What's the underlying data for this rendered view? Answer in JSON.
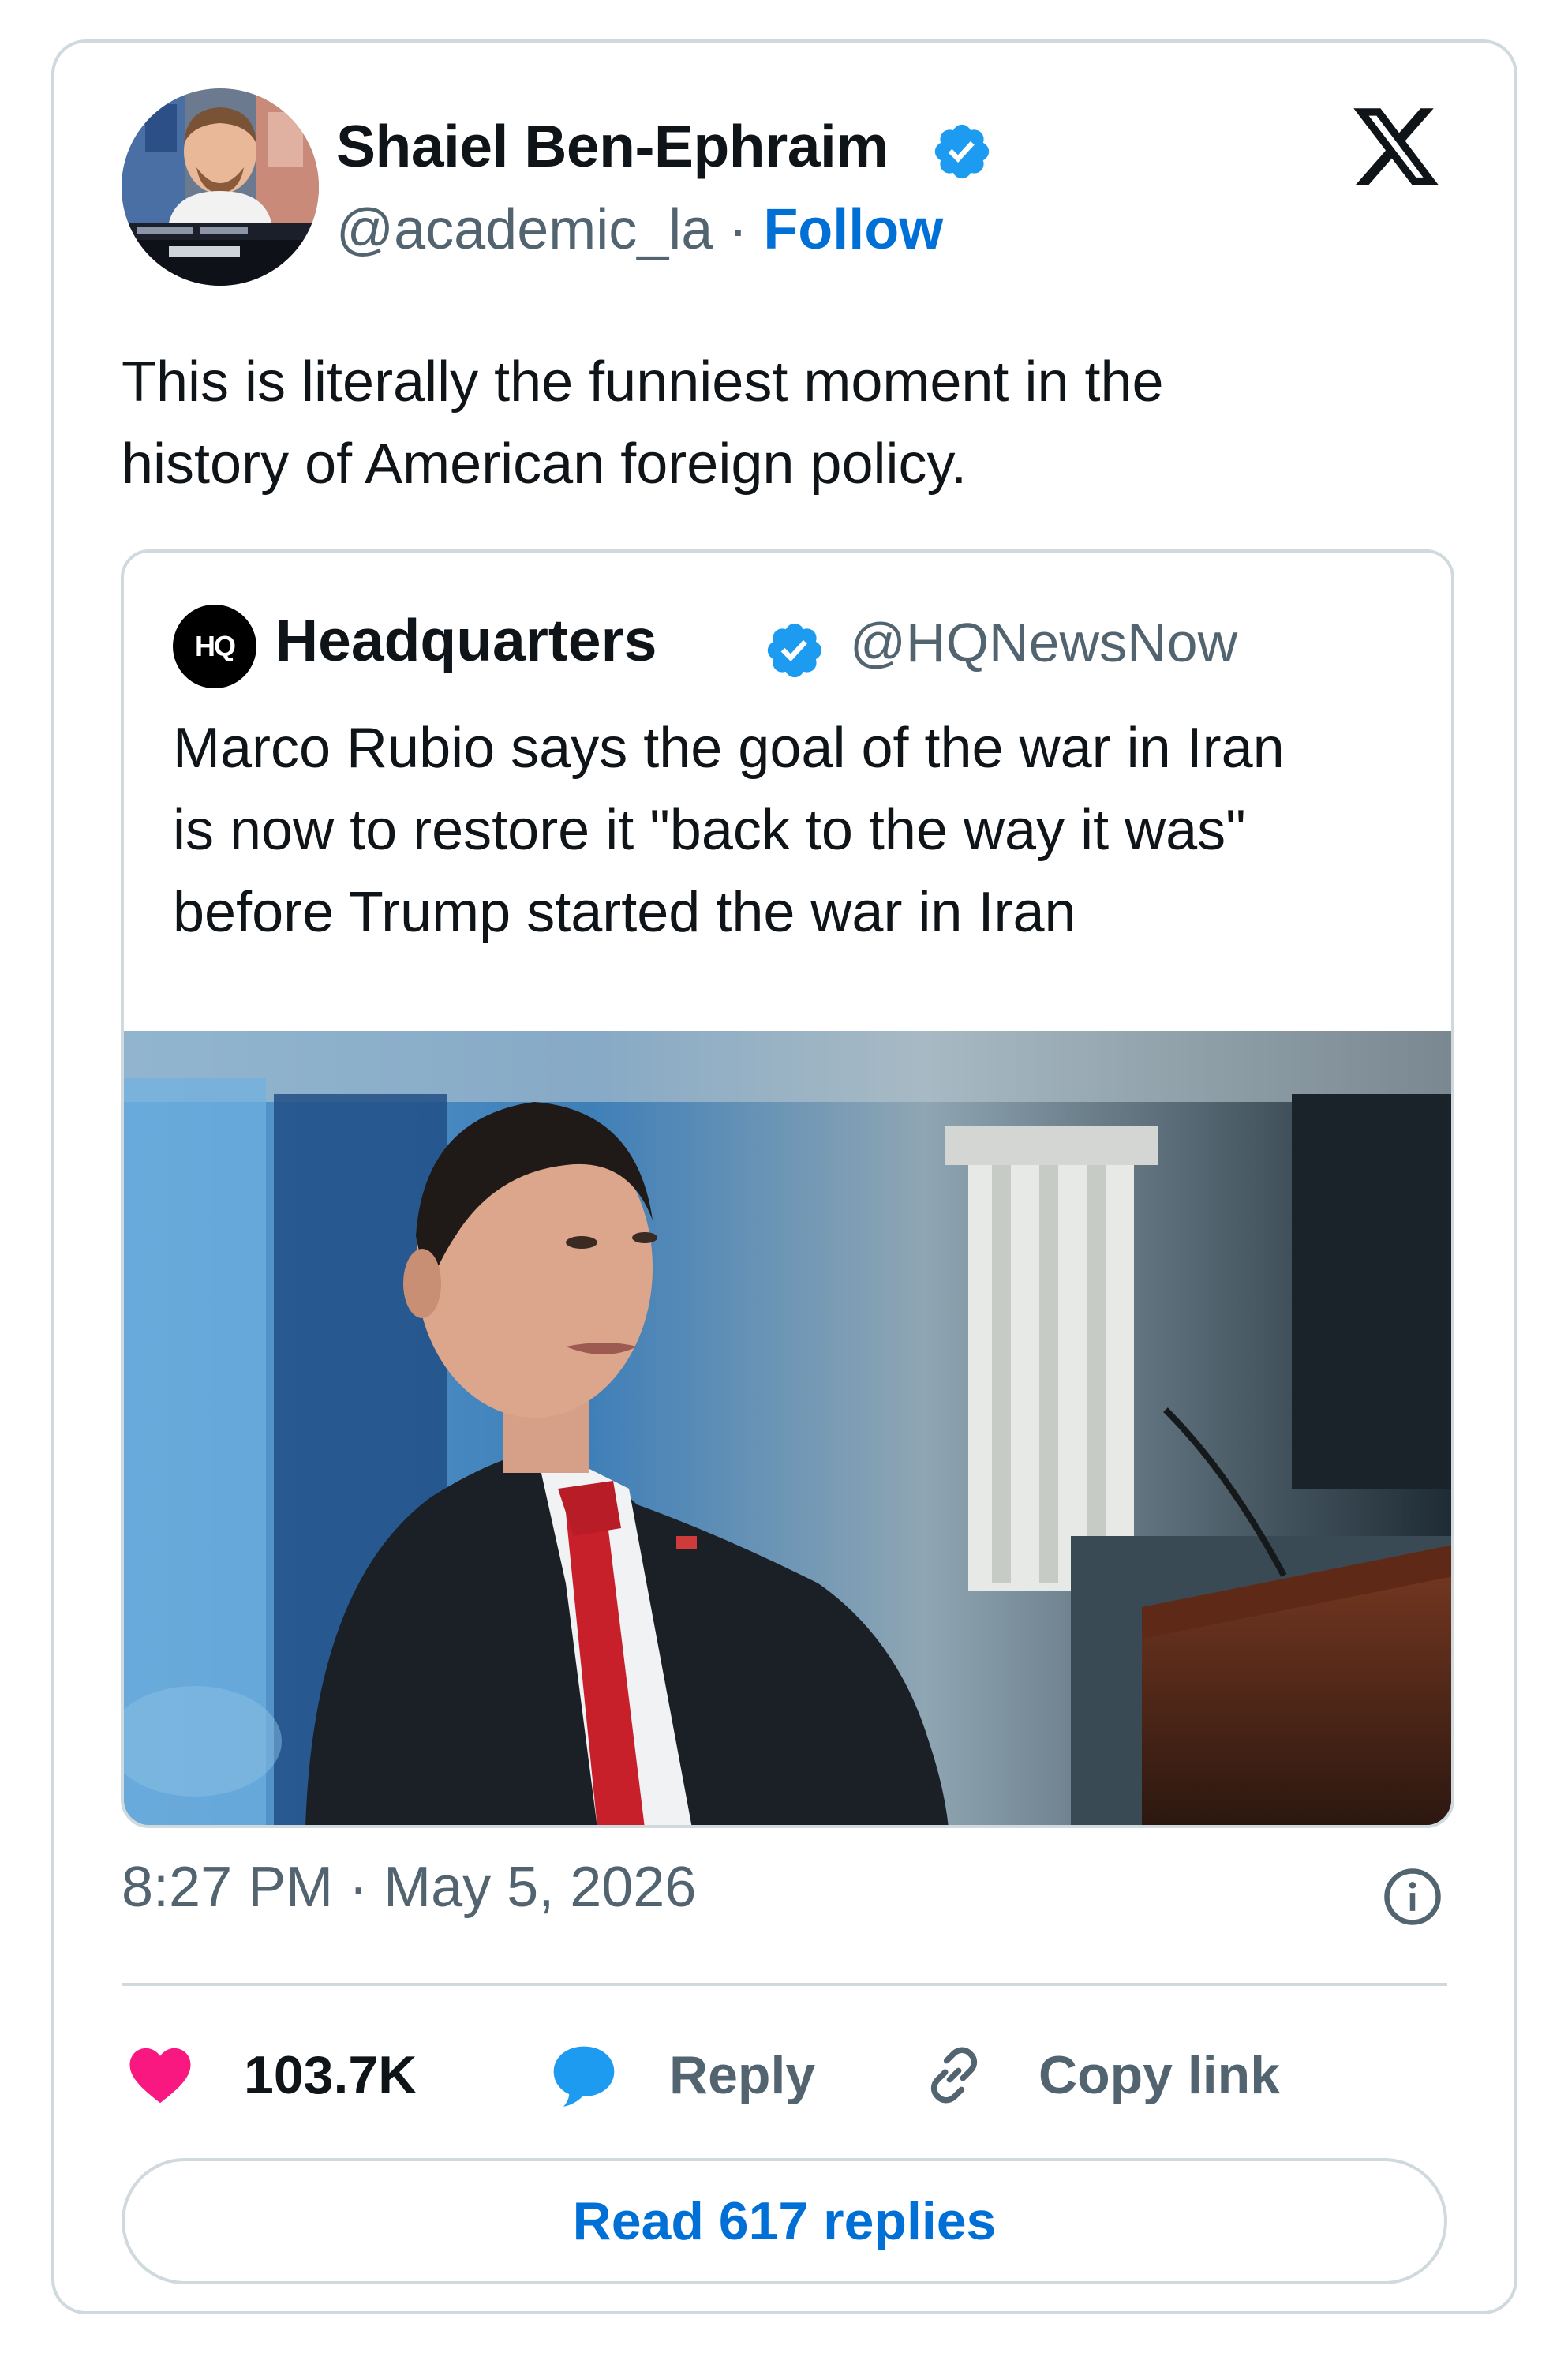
{
  "author": {
    "name": "Shaiel Ben-Ephraim",
    "handle": "@academic_la",
    "separator": " · ",
    "follow_label": "Follow"
  },
  "tweet": {
    "text_line1": "This is literally the funniest moment in the",
    "text_line2": "history of American foreign policy."
  },
  "quoted_tweet": {
    "logo_text": "HQ",
    "name": "Headquarters",
    "handle": "@HQNewsNow",
    "text_line1": "Marco Rubio says the goal of the war in Iran",
    "text_line2": "is now to restore it \"back to the way it was\"",
    "text_line3": "before Trump started the war in Iran"
  },
  "meta": {
    "timestamp": "8:27 PM · May 5, 2026"
  },
  "actions": {
    "likes": "103.7K",
    "reply_label": "Reply",
    "copy_link_label": "Copy link",
    "read_replies_label": "Read 617 replies"
  },
  "colors": {
    "link_blue": "#006fd6",
    "verified_blue": "#1d9bf0",
    "heart_pink": "#f91880",
    "border_gray": "#cfd9de",
    "secondary_text": "#536471"
  },
  "icons": [
    "verified-badge-icon",
    "x-logo-icon",
    "info-icon",
    "heart-icon",
    "reply-bubble-icon",
    "link-icon"
  ]
}
